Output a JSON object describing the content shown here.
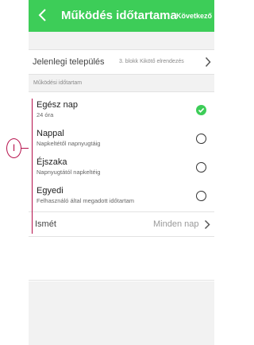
{
  "header": {
    "title": "Működés időtartama",
    "next_label": "Következő",
    "back_icon": "chevron-left-icon",
    "background_color": "#3dcd58"
  },
  "current_setting": {
    "label": "Jelenlegi település",
    "value": "3. blokk Kikötő elrendezés"
  },
  "duration_section": {
    "label": "Működési időtartam",
    "options": [
      {
        "title": "Egész nap",
        "subtitle": "24 óra",
        "selected": true
      },
      {
        "title": "Nappal",
        "subtitle": "Napkeltétől napnyugtáig",
        "selected": false
      },
      {
        "title": "Éjszaka",
        "subtitle": "Napnyugtától napkeltéig",
        "selected": false
      },
      {
        "title": "Egyedi",
        "subtitle": "Felhasználó által megadott időtartam",
        "selected": false
      }
    ]
  },
  "repeat": {
    "label": "Ismét",
    "value": "Minden nap"
  },
  "callout": {
    "marker": "I",
    "color": "#b50e4a"
  }
}
